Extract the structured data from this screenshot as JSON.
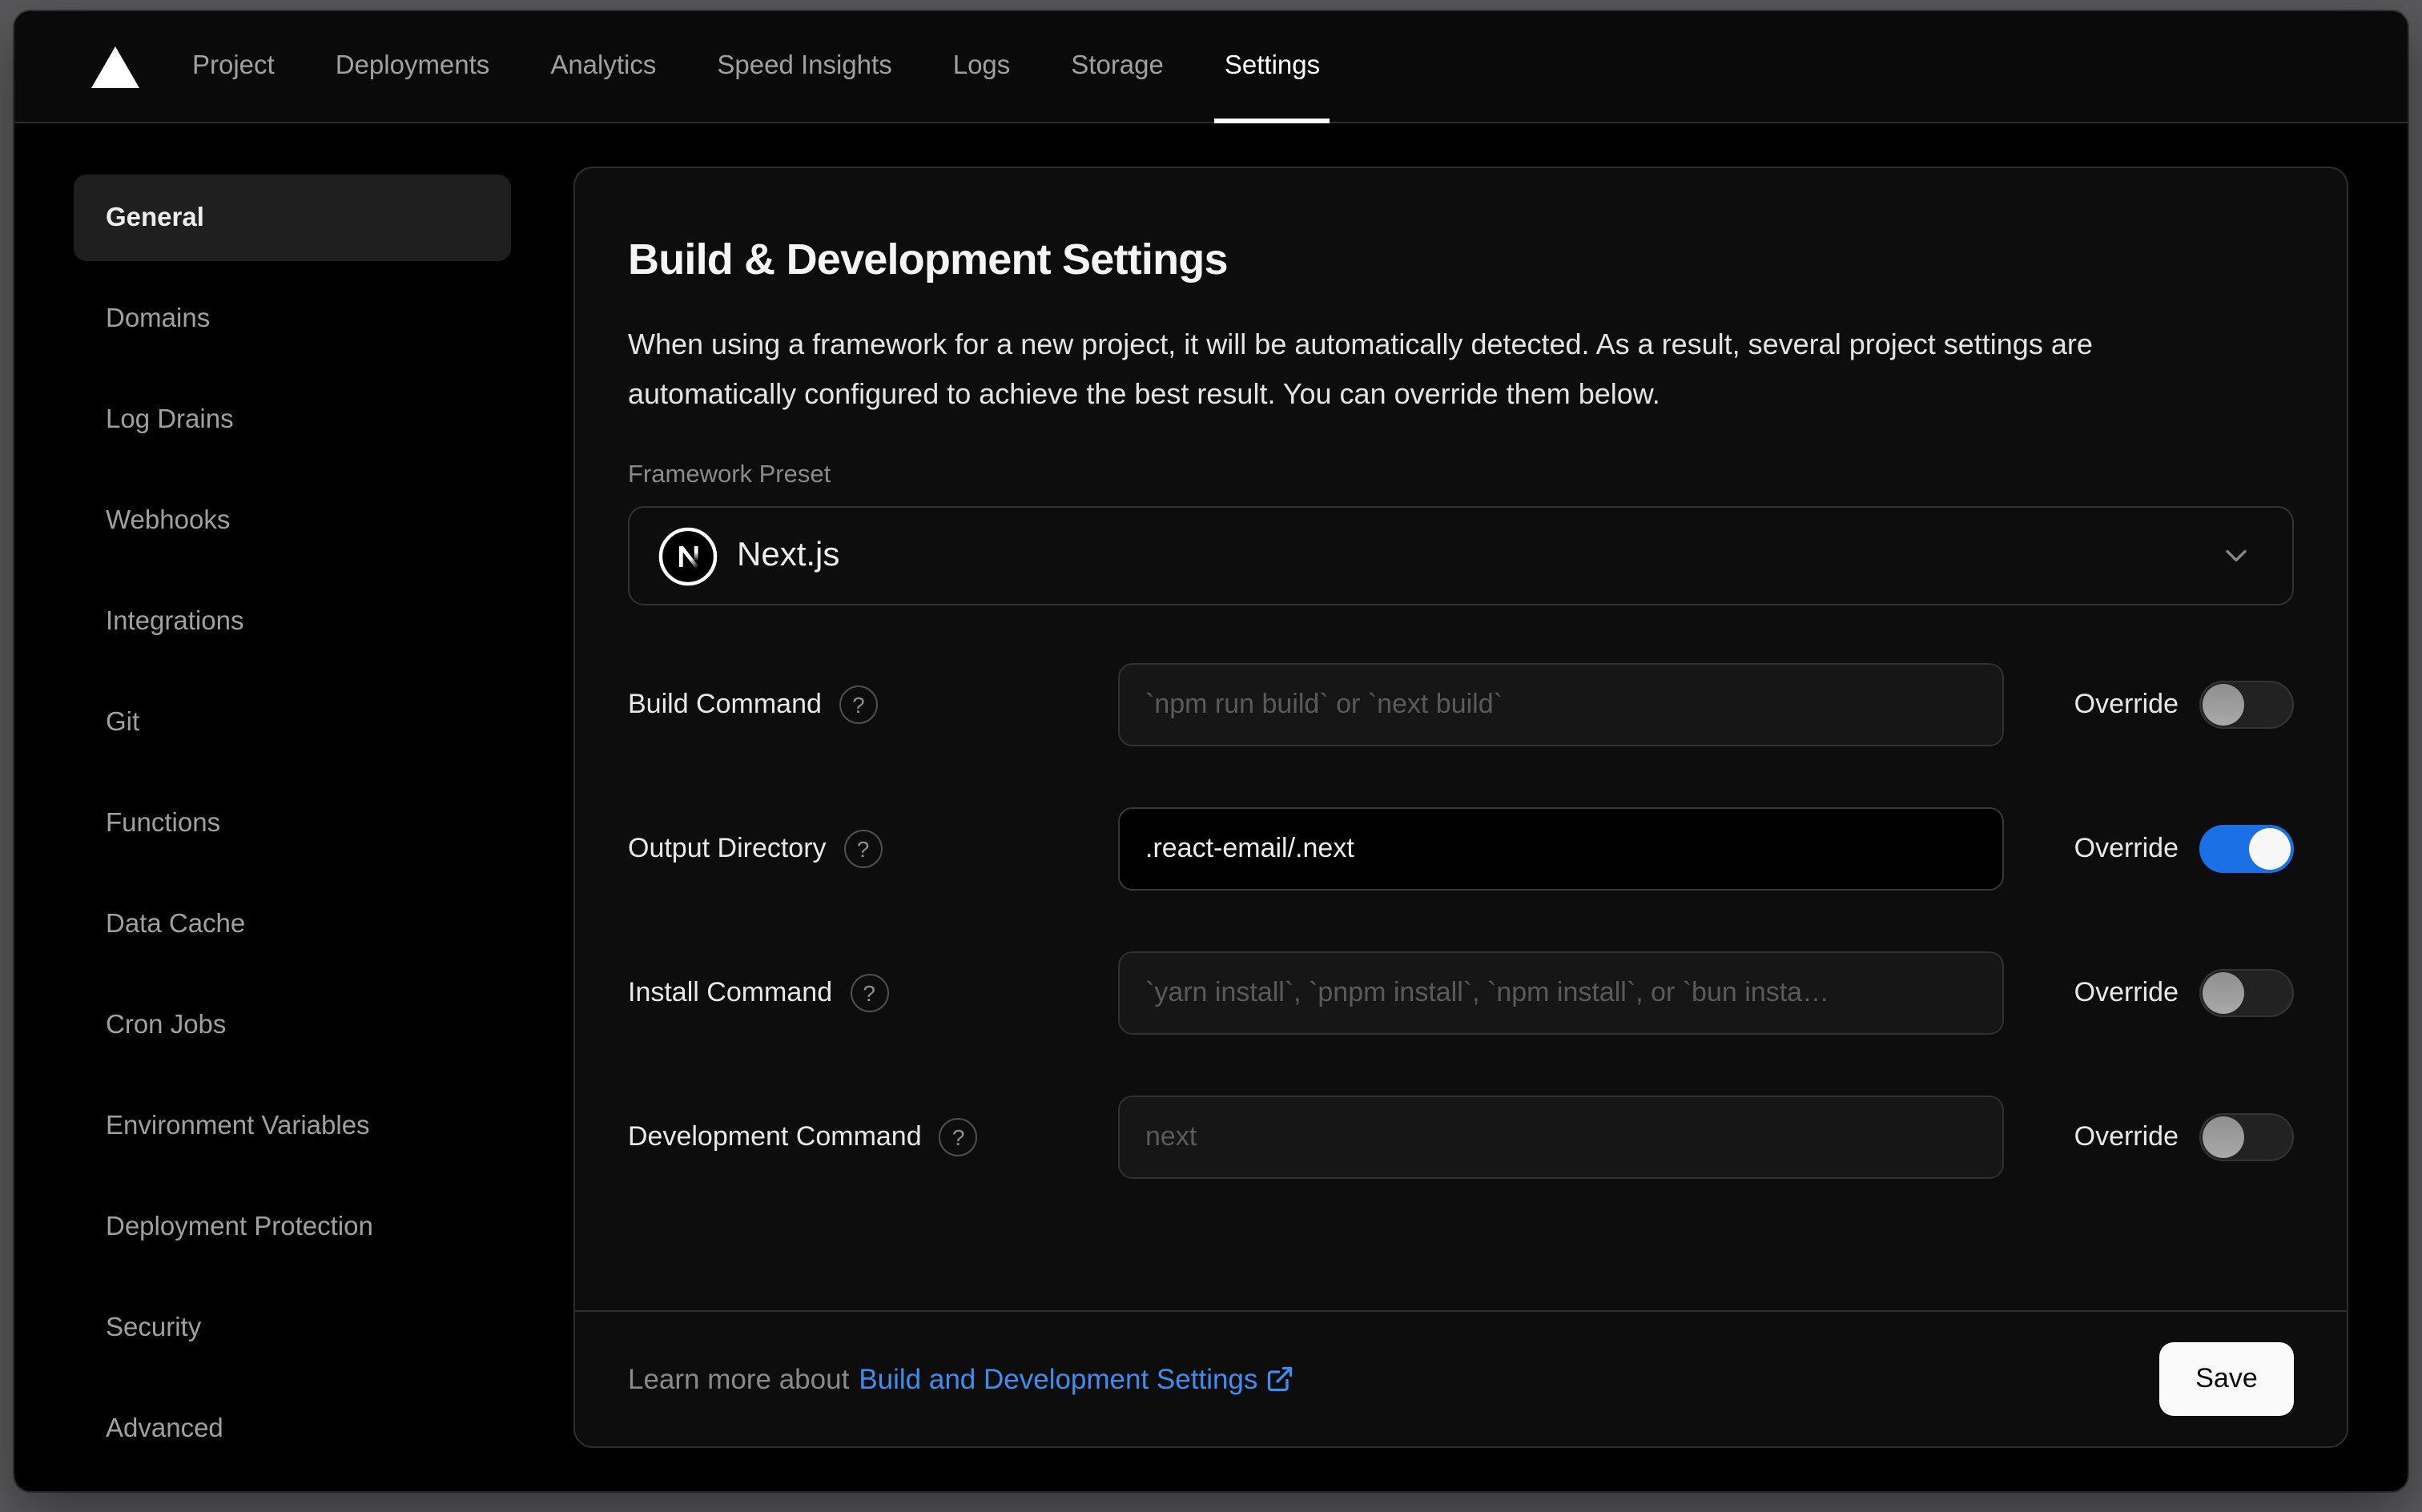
{
  "nav": {
    "tabs": [
      "Project",
      "Deployments",
      "Analytics",
      "Speed Insights",
      "Logs",
      "Storage",
      "Settings"
    ],
    "active_tab": "Settings"
  },
  "sidebar": {
    "items": [
      "General",
      "Domains",
      "Log Drains",
      "Webhooks",
      "Integrations",
      "Git",
      "Functions",
      "Data Cache",
      "Cron Jobs",
      "Environment Variables",
      "Deployment Protection",
      "Security",
      "Advanced"
    ],
    "active_item": "General"
  },
  "panel": {
    "title": "Build & Development Settings",
    "description": "When using a framework for a new project, it will be automatically detected. As a result, several project settings are automatically configured to achieve the best result. You can override them below.",
    "framework_preset": {
      "label": "Framework Preset",
      "value": "Next.js"
    },
    "fields": [
      {
        "label": "Build Command",
        "placeholder": "`npm run build` or `next build`",
        "value": "",
        "override": false
      },
      {
        "label": "Output Directory",
        "placeholder": "",
        "value": ".react-email/.next",
        "override": true
      },
      {
        "label": "Install Command",
        "placeholder": "`yarn install`, `pnpm install`, `npm install`, or `bun insta…",
        "value": "",
        "override": false
      },
      {
        "label": "Development Command",
        "placeholder": "next",
        "value": "",
        "override": false
      }
    ],
    "override_labels": [
      "Override",
      "Override",
      "Override",
      "Override"
    ],
    "footer": {
      "learn_more_prefix": "Learn more about",
      "link_text": "Build and Development Settings",
      "save_label": "Save"
    }
  },
  "colors": {
    "toggle_on_blue": "#1b70e5",
    "link_blue": "#3e8ef0",
    "card_background": "#0d0d0d",
    "window_background": "#000000"
  }
}
